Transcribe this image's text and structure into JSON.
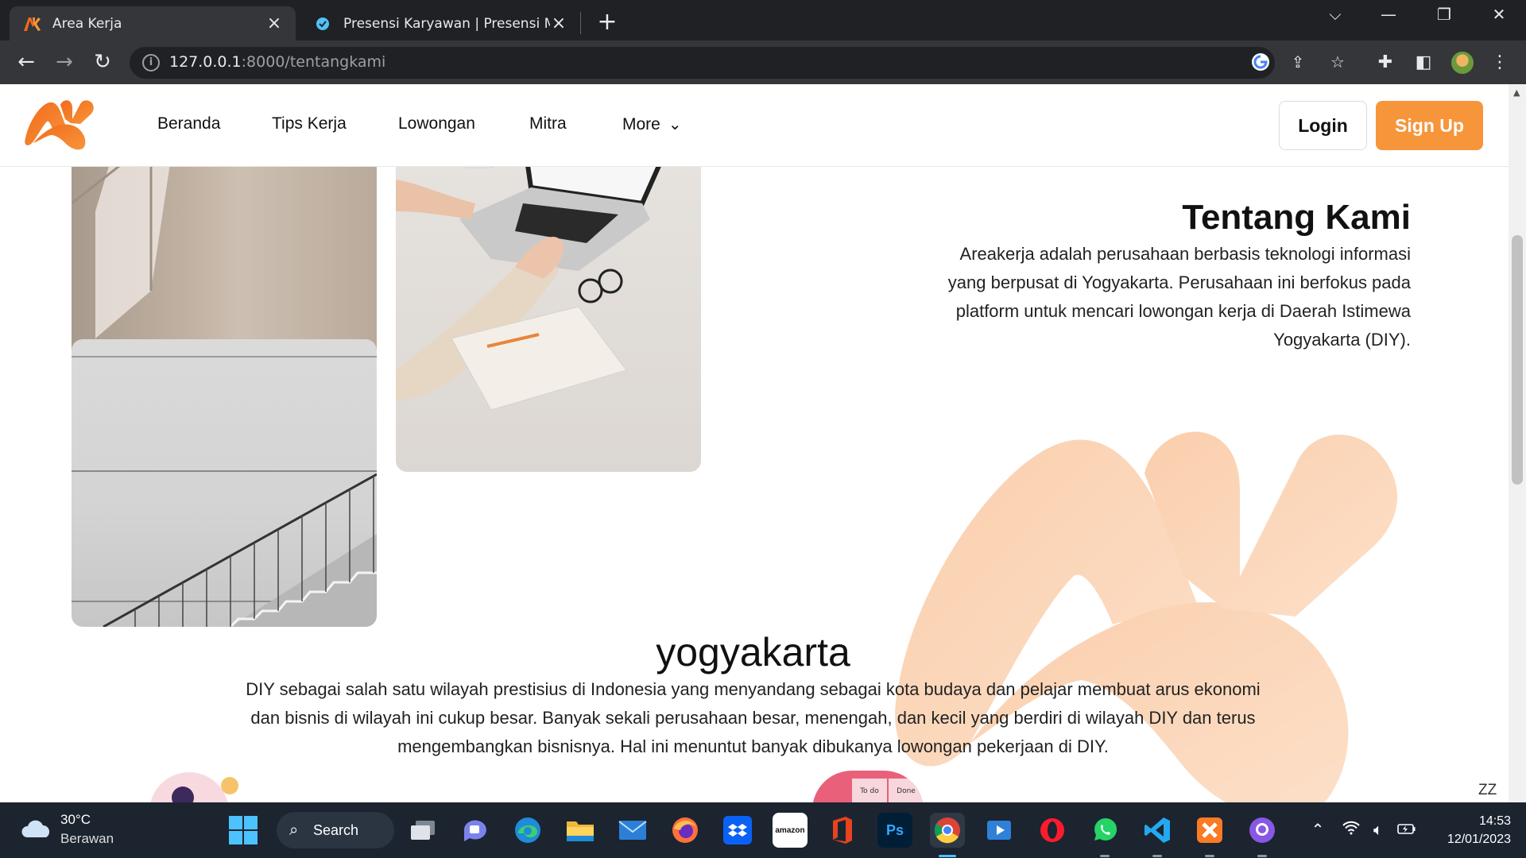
{
  "browser": {
    "tabs": [
      {
        "title": "Area Kerja",
        "active": true
      },
      {
        "title": "Presensi Karyawan | Presensi Mag",
        "active": false
      }
    ],
    "url_host": "127.0.0.1",
    "url_path": ":8000/tentangkami",
    "icons": [
      "back-icon",
      "forward-icon",
      "reload-icon",
      "info-icon",
      "google-icon",
      "share-icon",
      "star-icon",
      "extensions-icon",
      "sidepanel-icon",
      "profile-avatar",
      "menu-icon"
    ]
  },
  "site": {
    "nav": [
      "Beranda",
      "Tips Kerja",
      "Lowongan",
      "Mitra",
      "More"
    ],
    "login_label": "Login",
    "signup_label": "Sign Up",
    "brand_color": "#f7953b"
  },
  "about": {
    "title": "Tentang Kami",
    "text": "Areakerja adalah perusahaan berbasis teknologi informasi yang berpusat di Yogyakarta. Perusahaan ini berfokus pada platform untuk mencari lowongan kerja di Daerah Istimewa Yogyakarta (DIY)."
  },
  "city": {
    "title": "yogyakarta",
    "text": "DIY sebagai salah satu wilayah prestisius di Indonesia yang menyandang sebagai kota budaya dan pelajar membuat arus ekonomi dan bisnis di wilayah ini cukup besar. Banyak sekali perusahaan besar, menengah, dan kecil yang berdiri di wilayah DIY dan terus mengembangkan bisnisnya. Hal ini menuntut banyak dibukanya lowongan pekerjaan di DIY."
  },
  "deco_notes": [
    "To do",
    "Done"
  ],
  "zz_label": "ZZ",
  "taskbar": {
    "weather_temp": "30°C",
    "weather_cond": "Berawan",
    "search_label": "Search",
    "time": "14:53",
    "date": "12/01/2023",
    "apps": [
      "task-view",
      "teams-chat",
      "edge",
      "file-explorer",
      "mail",
      "firefox",
      "dropbox",
      "amazon",
      "office",
      "photoshop",
      "chrome",
      "media-player",
      "opera",
      "whatsapp",
      "vscode",
      "xampp",
      "github-desktop"
    ],
    "app_labels": {
      "amazon": "amazon",
      "photoshop": "Ps"
    }
  }
}
